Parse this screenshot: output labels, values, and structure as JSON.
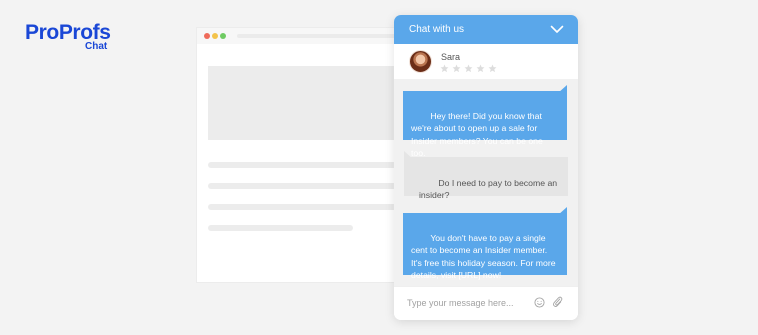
{
  "brand": {
    "logo_text": "ProProfs",
    "sub_text": "Chat"
  },
  "chat": {
    "header_title": "Chat with us",
    "agent_name": "Sara",
    "rating_max": 5,
    "messages": [
      {
        "from": "agent",
        "text": "Hey there! Did you know that we're about to open up a sale for Insider members? You can be one too."
      },
      {
        "from": "user",
        "text": "Do I need to pay to become an insider?"
      },
      {
        "from": "agent",
        "text": "You don't have to pay a single cent to become an Insider member. It's free this holiday season. For more details, visit [URL] now!"
      }
    ],
    "input_placeholder": "Type your message here...",
    "colors": {
      "header": "#5aa7ea",
      "agent_bubble": "#5aa7ea",
      "user_bubble": "#e5e5e5"
    }
  }
}
